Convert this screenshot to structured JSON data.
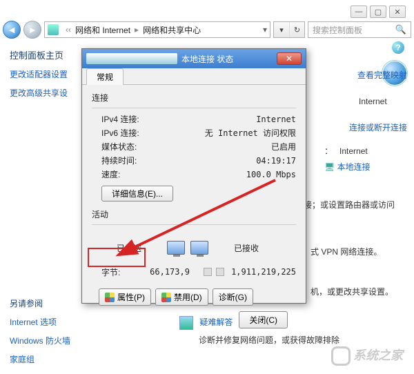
{
  "breadcrumb": {
    "seg1": "网络和 Internet",
    "seg2": "网络和共享中心"
  },
  "search": {
    "placeholder": "搜索控制面板"
  },
  "sidebar": {
    "heading": "控制面板主页",
    "links": [
      "更改适配器设置",
      "更改高级共享设",
      ""
    ],
    "see_also": "另请参阅",
    "see_also_items": [
      "Internet 选项",
      "Windows 防火墙",
      "家庭组"
    ]
  },
  "right": {
    "view_map": "查看完整映射",
    "internet_label": "Internet",
    "connect_disconnect": "连接或断开连接",
    "access_label_suffix": "：",
    "access_value": "Internet",
    "connection_link": "本地连接",
    "connect_frag": "接；或设置路由器或访问",
    "vpn_frag": "式 VPN 网络连接。",
    "change_frag": "机，或更改共享设置。",
    "troubleshoot": "疑难解答",
    "troubleshoot_desc": "诊断并修复网络问题，或获得故障排除"
  },
  "dialog": {
    "title": "本地连接 状态",
    "tab": "常规",
    "section_connection": "连接",
    "rows": {
      "ipv4_k": "IPv4 连接:",
      "ipv4_v": "Internet",
      "ipv6_k": "IPv6 连接:",
      "ipv6_v": "无 Internet 访问权限",
      "media_k": "媒体状态:",
      "media_v": "已启用",
      "duration_k": "持续时间:",
      "duration_v": "04:19:17",
      "speed_k": "速度:",
      "speed_v": "100.0 Mbps"
    },
    "details_btn": "详细信息(E)...",
    "section_activity": "活动",
    "sent_label": "已发送",
    "recv_label": "已接收",
    "bytes_label": "字节:",
    "bytes_sent": "66,173,9",
    "bytes_recv": "1,911,219,225",
    "btn_props": "属性(P)",
    "btn_disable": "禁用(D)",
    "btn_diag": "诊断(G)",
    "btn_close": "关闭(C)"
  },
  "watermark": "系统之家"
}
